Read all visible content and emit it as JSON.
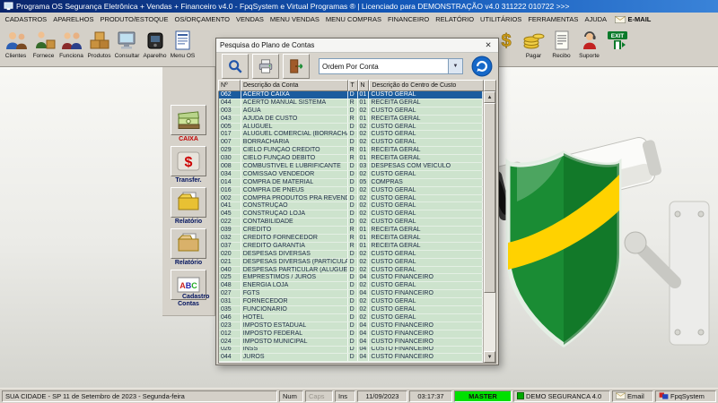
{
  "titlebar": {
    "title": "Programa OS Segurança Eletrônica + Vendas + Financeiro v4.0 - FpqSystem e Virtual Programas ® | Licenciado para DEMONSTRAÇÃO v4.0 311222 010722 >>>"
  },
  "menubar": {
    "items": [
      "CADASTROS",
      "APARELHOS",
      "PRODUTO/ESTOQUE",
      "OS/ORÇAMENTO",
      "VENDAS",
      "MENU VENDAS",
      "MENU COMPRAS",
      "FINANCEIRO",
      "RELATÓRIO",
      "UTILITÁRIOS",
      "FERRAMENTAS",
      "AJUDA"
    ],
    "email_label": "E-MAIL"
  },
  "toolbar": {
    "left_buttons": [
      {
        "label": "Clientes",
        "icon": "clients-icon"
      },
      {
        "label": "Fornece",
        "icon": "supplier-icon"
      },
      {
        "label": "Funciona",
        "icon": "employee-icon"
      },
      {
        "label": "Produtos",
        "icon": "products-icon"
      },
      {
        "label": "Consultar",
        "icon": "consult-icon"
      },
      {
        "label": "Aparelho",
        "icon": "device-icon"
      },
      {
        "label": "Menu OS",
        "icon": "service-order-icon"
      }
    ],
    "right_buttons": [
      {
        "label": "",
        "icon": "money-icon"
      },
      {
        "label": "Pagar",
        "icon": "coins-icon"
      },
      {
        "label": "Recibo",
        "icon": "receipt-icon"
      },
      {
        "label": "Suporte",
        "icon": "support-icon"
      },
      {
        "label": "",
        "icon": "exit-icon"
      }
    ]
  },
  "sidebar": {
    "items": [
      {
        "label": "CAIXA",
        "icon": "cash-icon",
        "color": "#c00000"
      },
      {
        "label": "Transfer.",
        "icon": "transfer-icon",
        "color": "#00125e"
      },
      {
        "label": "Relatório",
        "icon": "report-icon",
        "color": "#00125e"
      },
      {
        "label": "Relatório",
        "icon": "report2-icon",
        "color": "#00125e"
      },
      {
        "label": "Contas",
        "icon": "abc-icon",
        "color": "#00125e"
      }
    ],
    "partial_label": "Cadastro"
  },
  "dialog": {
    "title": "Pesquisa do Plano de Contas",
    "close_glyph": "✕",
    "combo_value": "Ordem Por Conta",
    "grid": {
      "columns": [
        "Nº",
        "Descrição da Conta",
        "T",
        "N",
        "Descrição do Centro de Custo"
      ],
      "selected_index": 0,
      "rows": [
        [
          "062",
          "ACERTO CAIXA",
          "D",
          "01",
          "CUSTO GERAL"
        ],
        [
          "044",
          "ACERTO MANUAL SISTEMA",
          "R",
          "01",
          "RECEITA GERAL"
        ],
        [
          "003",
          "ÁGUA",
          "D",
          "02",
          "CUSTO GERAL"
        ],
        [
          "043",
          "AJUDA DE CUSTO",
          "R",
          "01",
          "RECEITA GERAL"
        ],
        [
          "005",
          "ALUGUEL",
          "D",
          "02",
          "CUSTO GERAL"
        ],
        [
          "017",
          "ALUGUEL COMERCIAL (BORRACHARIA)",
          "D",
          "02",
          "CUSTO GERAL"
        ],
        [
          "007",
          "BORRACHARIA",
          "D",
          "02",
          "CUSTO GERAL"
        ],
        [
          "029",
          "CIELO FUNÇÃO CRÉDITO",
          "R",
          "01",
          "RECEITA GERAL"
        ],
        [
          "030",
          "CIELO FUNÇÃO DÉBITO",
          "R",
          "01",
          "RECEITA GERAL"
        ],
        [
          "008",
          "COMBUSTÍVEL E LUBRIFICANTE",
          "D",
          "03",
          "DESPESAS COM VEICULO"
        ],
        [
          "034",
          "COMISSÃO VENDEDOR",
          "D",
          "02",
          "CUSTO GERAL"
        ],
        [
          "014",
          "COMPRA DE MATERIAL",
          "D",
          "05",
          "COMPRAS"
        ],
        [
          "016",
          "COMPRA DE PNEUS",
          "D",
          "02",
          "CUSTO GERAL"
        ],
        [
          "002",
          "COMPRA PRODUTOS PRA REVENDA",
          "D",
          "02",
          "CUSTO GERAL"
        ],
        [
          "041",
          "CONSTRUÇÃO",
          "D",
          "02",
          "CUSTO GERAL"
        ],
        [
          "045",
          "CONSTRUÇÃO LOJA",
          "D",
          "02",
          "CUSTO GERAL"
        ],
        [
          "022",
          "CONTABILIDADE",
          "D",
          "02",
          "CUSTO GERAL"
        ],
        [
          "039",
          "CRÉDITO",
          "R",
          "01",
          "RECEITA GERAL"
        ],
        [
          "032",
          "CRÉDITO FORNECEDOR",
          "R",
          "01",
          "RECEITA GERAL"
        ],
        [
          "037",
          "CRÉDITO GARANTIA",
          "R",
          "01",
          "RECEITA GERAL"
        ],
        [
          "020",
          "DESPESAS DIVERSAS",
          "D",
          "02",
          "CUSTO GERAL"
        ],
        [
          "021",
          "DESPESAS DIVERSAS (PARTICULAR)",
          "D",
          "02",
          "CUSTO GERAL"
        ],
        [
          "040",
          "DESPESAS PARTICULAR (ALUGUEL CASA)",
          "D",
          "02",
          "CUSTO GERAL"
        ],
        [
          "025",
          "EMPRÉSTIMOS / JUROS",
          "D",
          "04",
          "CUSTO FINANCEIRO"
        ],
        [
          "048",
          "ENERGIA LOJA",
          "D",
          "02",
          "CUSTO GERAL"
        ],
        [
          "027",
          "FGTS",
          "D",
          "04",
          "CUSTO FINANCEIRO"
        ],
        [
          "031",
          "FORNECEDOR",
          "D",
          "02",
          "CUSTO GERAL"
        ],
        [
          "035",
          "FUNCIONARIO",
          "D",
          "02",
          "CUSTO GERAL"
        ],
        [
          "046",
          "HOTEL",
          "D",
          "02",
          "CUSTO GERAL"
        ],
        [
          "023",
          "IMPOSTO ESTADUAL",
          "D",
          "04",
          "CUSTO FINANCEIRO"
        ],
        [
          "012",
          "IMPOSTO FEDERAL",
          "D",
          "04",
          "CUSTO FINANCEIRO"
        ],
        [
          "024",
          "IMPOSTO MUNICIPAL",
          "D",
          "04",
          "CUSTO FINANCEIRO"
        ],
        [
          "026",
          "INSS",
          "D",
          "04",
          "CUSTO FINANCEIRO"
        ],
        [
          "044",
          "JUROS",
          "D",
          "04",
          "CUSTO FINANCEIRO"
        ]
      ]
    }
  },
  "statusbar": {
    "location": "SUA CIDADE - SP 11 de Setembro de 2023 - Segunda-feira",
    "num": "Num",
    "caps": "Caps",
    "ins": "Ins",
    "date": "11/09/2023",
    "time": "03:17:37",
    "user": "MASTER",
    "product": "DEMO SEGURANCA 4.0",
    "email": "Email",
    "brand": "FpqSystem"
  },
  "colors": {
    "titlebar_blue": "#0a246a",
    "grid_row_green": "#cde3cd",
    "selection_blue": "#1b5c9e",
    "master_green": "#00e000",
    "shield_green": "#1a8c34",
    "shield_yellow": "#ffd200"
  }
}
